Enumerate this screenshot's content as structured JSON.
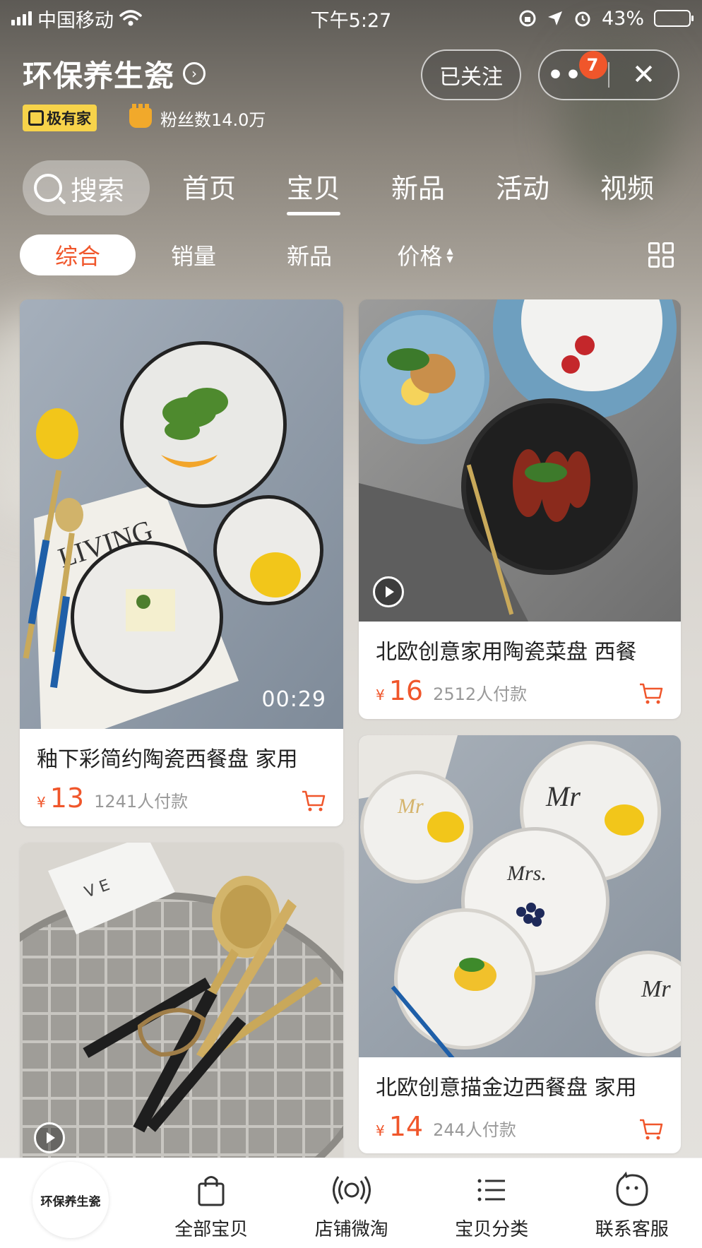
{
  "status_bar": {
    "carrier": "中国移动",
    "time": "下午5:27",
    "battery_percent": "43%",
    "battery_level": 0.43
  },
  "shop": {
    "name": "环保养生瓷",
    "badge": "极有家",
    "fans": "粉丝数14.0万",
    "follow_label": "已关注",
    "notification_count": "7"
  },
  "nav": {
    "search_label": "搜索",
    "tabs": [
      "首页",
      "宝贝",
      "新品",
      "活动",
      "视频"
    ],
    "active_tab": "宝贝"
  },
  "sort": {
    "items": [
      "综合",
      "销量",
      "新品",
      "价格"
    ],
    "active": "综合"
  },
  "products": [
    {
      "title": "釉下彩简约陶瓷西餐盘 家用",
      "currency": "¥",
      "price": "13",
      "sold": "1241人付款",
      "video_duration": "00:29"
    },
    {
      "title": "北欧创意家用陶瓷菜盘 西餐",
      "currency": "¥",
      "price": "16",
      "sold": "2512人付款"
    },
    {
      "title": "北欧创意描金边西餐盘 家用",
      "currency": "¥",
      "price": "14",
      "sold": "244人付款"
    }
  ],
  "image_text": {
    "magazine_word": "LIVING",
    "card_letters": "V E",
    "plate_mr": "Mr",
    "plate_mrs": "Mrs."
  },
  "tabbar": {
    "shop_avatar_text": "环保养生瓷",
    "items": [
      "全部宝贝",
      "店铺微淘",
      "宝贝分类",
      "联系客服"
    ]
  },
  "colors": {
    "accent": "#f0562b",
    "badge_yellow": "#f7d34a"
  }
}
